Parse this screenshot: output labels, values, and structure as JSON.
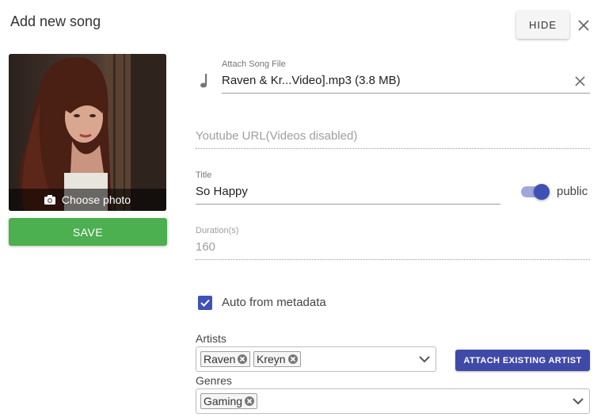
{
  "dialog": {
    "title": "Add new song",
    "hide_label": "HIDE"
  },
  "photo": {
    "choose_label": "Choose photo"
  },
  "save_label": "SAVE",
  "attach_file": {
    "label": "Attach Song File",
    "value": "Raven & Kr...Video].mp3 (3.8 MB)"
  },
  "youtube": {
    "placeholder": "Youtube URL(Videos disabled)"
  },
  "title_field": {
    "label": "Title",
    "value": "So Happy"
  },
  "public_toggle": {
    "label": "public",
    "on": true
  },
  "duration": {
    "label": "Duration(s)",
    "value": "160"
  },
  "auto_metadata": {
    "label": "Auto from metadata",
    "checked": true
  },
  "artists": {
    "label": "Artists",
    "chips": [
      "Raven",
      "Kreyn"
    ],
    "attach_label": "ATTACH EXISTING ARTIST"
  },
  "genres": {
    "label": "Genres",
    "chips": [
      "Gaming"
    ]
  },
  "colors": {
    "primary": "#3f51b5",
    "save": "#4caf50",
    "attach": "#3f4aa8"
  }
}
